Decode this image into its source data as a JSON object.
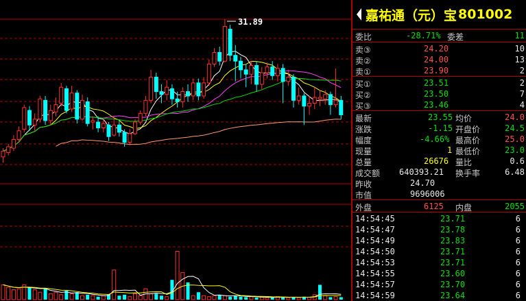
{
  "header": {
    "name": "嘉祐通（元）宝",
    "code": "801002"
  },
  "chart": {
    "peak_label": "31.89",
    "candles": [
      {
        "o": 22.4,
        "c": 22.8,
        "h": 23.0,
        "l": 22.0,
        "dir": "up"
      },
      {
        "o": 22.7,
        "c": 23.1,
        "h": 23.3,
        "l": 22.5,
        "dir": "up"
      },
      {
        "o": 23.0,
        "c": 23.6,
        "h": 23.9,
        "l": 22.8,
        "dir": "up"
      },
      {
        "o": 23.6,
        "c": 24.2,
        "h": 24.5,
        "l": 23.4,
        "dir": "up"
      },
      {
        "o": 24.3,
        "c": 25.8,
        "h": 26.0,
        "l": 24.1,
        "dir": "up"
      },
      {
        "o": 25.6,
        "c": 24.6,
        "h": 25.9,
        "l": 24.2,
        "dir": "down"
      },
      {
        "o": 24.6,
        "c": 25.0,
        "h": 25.4,
        "l": 24.2,
        "dir": "up"
      },
      {
        "o": 25.0,
        "c": 26.4,
        "h": 26.6,
        "l": 24.8,
        "dir": "up"
      },
      {
        "o": 26.3,
        "c": 24.9,
        "h": 26.6,
        "l": 24.6,
        "dir": "down"
      },
      {
        "o": 24.9,
        "c": 25.6,
        "h": 26.0,
        "l": 24.6,
        "dir": "up"
      },
      {
        "o": 25.5,
        "c": 26.0,
        "h": 26.5,
        "l": 25.2,
        "dir": "up"
      },
      {
        "o": 26.1,
        "c": 27.2,
        "h": 27.5,
        "l": 25.9,
        "dir": "up"
      },
      {
        "o": 27.1,
        "c": 25.6,
        "h": 27.3,
        "l": 25.4,
        "dir": "down"
      },
      {
        "o": 25.7,
        "c": 26.8,
        "h": 27.3,
        "l": 25.5,
        "dir": "up"
      },
      {
        "o": 26.8,
        "c": 25.0,
        "h": 27.0,
        "l": 24.7,
        "dir": "down"
      },
      {
        "o": 25.0,
        "c": 26.3,
        "h": 26.7,
        "l": 24.9,
        "dir": "up"
      },
      {
        "o": 26.2,
        "c": 24.7,
        "h": 26.5,
        "l": 24.5,
        "dir": "down"
      },
      {
        "o": 24.8,
        "c": 24.9,
        "h": 25.2,
        "l": 24.3,
        "dir": "up"
      },
      {
        "o": 24.8,
        "c": 24.4,
        "h": 25.2,
        "l": 24.1,
        "dir": "down"
      },
      {
        "o": 24.4,
        "c": 24.7,
        "h": 25.0,
        "l": 24.1,
        "dir": "up"
      },
      {
        "o": 24.6,
        "c": 23.8,
        "h": 24.8,
        "l": 23.5,
        "dir": "down"
      },
      {
        "o": 23.9,
        "c": 24.6,
        "h": 25.2,
        "l": 23.8,
        "dir": "up"
      },
      {
        "o": 24.6,
        "c": 24.1,
        "h": 24.9,
        "l": 23.8,
        "dir": "down"
      },
      {
        "o": 24.1,
        "c": 23.4,
        "h": 24.3,
        "l": 23.1,
        "dir": "down"
      },
      {
        "o": 23.4,
        "c": 24.0,
        "h": 24.3,
        "l": 23.2,
        "dir": "up"
      },
      {
        "o": 24.0,
        "c": 24.8,
        "h": 25.0,
        "l": 23.9,
        "dir": "up"
      },
      {
        "o": 24.8,
        "c": 25.4,
        "h": 25.6,
        "l": 24.6,
        "dir": "up"
      },
      {
        "o": 25.4,
        "c": 26.3,
        "h": 26.6,
        "l": 25.2,
        "dir": "up"
      },
      {
        "o": 26.3,
        "c": 27.9,
        "h": 28.4,
        "l": 26.1,
        "dir": "up"
      },
      {
        "o": 27.9,
        "c": 26.9,
        "h": 28.2,
        "l": 26.4,
        "dir": "down"
      },
      {
        "o": 26.9,
        "c": 26.7,
        "h": 27.4,
        "l": 26.1,
        "dir": "down"
      },
      {
        "o": 26.7,
        "c": 27.2,
        "h": 27.7,
        "l": 26.3,
        "dir": "up"
      },
      {
        "o": 27.1,
        "c": 26.4,
        "h": 27.4,
        "l": 26.0,
        "dir": "down"
      },
      {
        "o": 26.4,
        "c": 26.2,
        "h": 26.9,
        "l": 25.8,
        "dir": "down"
      },
      {
        "o": 26.2,
        "c": 26.9,
        "h": 27.2,
        "l": 25.8,
        "dir": "up"
      },
      {
        "o": 26.9,
        "c": 26.6,
        "h": 27.4,
        "l": 26.2,
        "dir": "down"
      },
      {
        "o": 26.6,
        "c": 27.5,
        "h": 27.8,
        "l": 26.3,
        "dir": "up"
      },
      {
        "o": 27.5,
        "c": 26.6,
        "h": 27.8,
        "l": 26.3,
        "dir": "down"
      },
      {
        "o": 26.6,
        "c": 27.5,
        "h": 27.9,
        "l": 26.4,
        "dir": "up"
      },
      {
        "o": 27.5,
        "c": 28.8,
        "h": 29.1,
        "l": 27.3,
        "dir": "up"
      },
      {
        "o": 28.8,
        "c": 29.6,
        "h": 29.9,
        "l": 28.6,
        "dir": "up"
      },
      {
        "o": 29.6,
        "c": 29.0,
        "h": 30.0,
        "l": 28.7,
        "dir": "down"
      },
      {
        "o": 29.0,
        "c": 31.4,
        "h": 31.89,
        "l": 28.9,
        "dir": "up"
      },
      {
        "o": 31.2,
        "c": 29.4,
        "h": 31.5,
        "l": 29.0,
        "dir": "down"
      },
      {
        "o": 29.4,
        "c": 29.0,
        "h": 30.1,
        "l": 27.6,
        "dir": "down"
      },
      {
        "o": 29.0,
        "c": 28.4,
        "h": 29.3,
        "l": 27.8,
        "dir": "down"
      },
      {
        "o": 28.4,
        "c": 28.1,
        "h": 28.8,
        "l": 27.2,
        "dir": "down"
      },
      {
        "o": 28.1,
        "c": 28.7,
        "h": 29.0,
        "l": 27.4,
        "dir": "up"
      },
      {
        "o": 28.7,
        "c": 27.4,
        "h": 29.0,
        "l": 26.9,
        "dir": "down"
      },
      {
        "o": 27.4,
        "c": 28.2,
        "h": 28.6,
        "l": 27.0,
        "dir": "up"
      },
      {
        "o": 28.2,
        "c": 28.6,
        "h": 28.9,
        "l": 27.8,
        "dir": "up"
      },
      {
        "o": 28.6,
        "c": 28.0,
        "h": 29.0,
        "l": 27.7,
        "dir": "down"
      },
      {
        "o": 28.0,
        "c": 28.5,
        "h": 28.8,
        "l": 27.6,
        "dir": "up"
      },
      {
        "o": 28.5,
        "c": 27.6,
        "h": 28.8,
        "l": 26.1,
        "dir": "down"
      },
      {
        "o": 27.6,
        "c": 27.9,
        "h": 28.4,
        "l": 27.3,
        "dir": "up"
      },
      {
        "o": 27.9,
        "c": 26.3,
        "h": 28.1,
        "l": 25.8,
        "dir": "down"
      },
      {
        "o": 26.3,
        "c": 26.6,
        "h": 27.2,
        "l": 26.0,
        "dir": "up"
      },
      {
        "o": 26.6,
        "c": 25.9,
        "h": 26.8,
        "l": 24.6,
        "dir": "down"
      },
      {
        "o": 25.9,
        "c": 26.1,
        "h": 26.6,
        "l": 25.3,
        "dir": "up"
      },
      {
        "o": 26.1,
        "c": 26.5,
        "h": 27.2,
        "l": 25.7,
        "dir": "up"
      },
      {
        "o": 26.5,
        "c": 26.4,
        "h": 27.0,
        "l": 25.9,
        "dir": "up"
      },
      {
        "o": 26.4,
        "c": 26.7,
        "h": 27.0,
        "l": 26.0,
        "dir": "up"
      },
      {
        "o": 26.7,
        "c": 26.0,
        "h": 26.9,
        "l": 25.3,
        "dir": "down"
      },
      {
        "o": 26.0,
        "c": 26.3,
        "h": 28.5,
        "l": 25.8,
        "dir": "up"
      },
      {
        "o": 26.3,
        "c": 25.3,
        "h": 26.6,
        "l": 25.0,
        "dir": "down"
      }
    ],
    "volumes": [
      {
        "v": 0.3,
        "dir": "up"
      },
      {
        "v": 0.25,
        "dir": "up"
      },
      {
        "v": 0.2,
        "dir": "up"
      },
      {
        "v": 0.22,
        "dir": "up"
      },
      {
        "v": 0.3,
        "dir": "up"
      },
      {
        "v": 0.25,
        "dir": "down"
      },
      {
        "v": 0.2,
        "dir": "up"
      },
      {
        "v": 0.15,
        "dir": "up"
      },
      {
        "v": 0.22,
        "dir": "down"
      },
      {
        "v": 0.12,
        "dir": "up"
      },
      {
        "v": 0.15,
        "dir": "up"
      },
      {
        "v": 0.1,
        "dir": "up"
      },
      {
        "v": 0.18,
        "dir": "down"
      },
      {
        "v": 0.12,
        "dir": "up"
      },
      {
        "v": 0.15,
        "dir": "down"
      },
      {
        "v": 0.08,
        "dir": "up"
      },
      {
        "v": 0.1,
        "dir": "down"
      },
      {
        "v": 0.08,
        "dir": "up"
      },
      {
        "v": 0.06,
        "dir": "down"
      },
      {
        "v": 0.08,
        "dir": "up"
      },
      {
        "v": 0.1,
        "dir": "down"
      },
      {
        "v": 0.6,
        "dir": "up"
      },
      {
        "v": 0.08,
        "dir": "down"
      },
      {
        "v": 0.1,
        "dir": "down"
      },
      {
        "v": 0.06,
        "dir": "up"
      },
      {
        "v": 0.12,
        "dir": "up"
      },
      {
        "v": 0.08,
        "dir": "up"
      },
      {
        "v": 0.22,
        "dir": "up"
      },
      {
        "v": 0.12,
        "dir": "up"
      },
      {
        "v": 0.12,
        "dir": "down"
      },
      {
        "v": 0.08,
        "dir": "down"
      },
      {
        "v": 0.06,
        "dir": "up"
      },
      {
        "v": 0.4,
        "dir": "down"
      },
      {
        "v": 0.98,
        "dir": "up"
      },
      {
        "v": 0.55,
        "dir": "up"
      },
      {
        "v": 0.35,
        "dir": "down"
      },
      {
        "v": 0.08,
        "dir": "up"
      },
      {
        "v": 0.15,
        "dir": "down"
      },
      {
        "v": 0.08,
        "dir": "up"
      },
      {
        "v": 0.06,
        "dir": "up"
      },
      {
        "v": 0.08,
        "dir": "up"
      },
      {
        "v": 0.1,
        "dir": "down"
      },
      {
        "v": 0.08,
        "dir": "up"
      },
      {
        "v": 0.06,
        "dir": "down"
      },
      {
        "v": 0.08,
        "dir": "down"
      },
      {
        "v": 0.06,
        "dir": "down"
      },
      {
        "v": 0.05,
        "dir": "down"
      },
      {
        "v": 0.06,
        "dir": "up"
      },
      {
        "v": 0.04,
        "dir": "down"
      },
      {
        "v": 0.05,
        "dir": "up"
      },
      {
        "v": 0.04,
        "dir": "up"
      },
      {
        "v": 0.05,
        "dir": "down"
      },
      {
        "v": 0.06,
        "dir": "up"
      },
      {
        "v": 0.05,
        "dir": "down"
      },
      {
        "v": 0.04,
        "dir": "up"
      },
      {
        "v": 0.05,
        "dir": "down"
      },
      {
        "v": 0.04,
        "dir": "up"
      },
      {
        "v": 0.06,
        "dir": "down"
      },
      {
        "v": 0.05,
        "dir": "up"
      },
      {
        "v": 0.1,
        "dir": "up"
      },
      {
        "v": 0.3,
        "dir": "down"
      },
      {
        "v": 0.08,
        "dir": "up"
      },
      {
        "v": 0.05,
        "dir": "down"
      },
      {
        "v": 0.06,
        "dir": "up"
      },
      {
        "v": 0.05,
        "dir": "down"
      }
    ],
    "colors": {
      "up": "#ff3030",
      "down": "#00ffff",
      "ma5": "#ffffff",
      "ma10": "#ffff00",
      "ma20": "#ff40ff",
      "ma30": "#00dd00",
      "ma60": "#ff9a70",
      "grid": "#b00000"
    }
  },
  "order_book": {
    "ratio_label": "委比",
    "ratio_value": "-28.71%",
    "diff_label": "委差",
    "diff_value": "11",
    "sells": [
      {
        "label": "卖③",
        "price": "24.20",
        "vol": "10"
      },
      {
        "label": "卖②",
        "price": "24.00",
        "vol": "13"
      },
      {
        "label": "卖①",
        "price": "23.90",
        "vol": "2"
      }
    ],
    "buys": [
      {
        "label": "买①",
        "price": "23.51",
        "vol": "2"
      },
      {
        "label": "买②",
        "price": "23.50",
        "vol": "7"
      },
      {
        "label": "买③",
        "price": "23.46",
        "vol": "4"
      }
    ]
  },
  "stats": {
    "latest_label": "最新",
    "latest": "23.55",
    "avg_label": "均价",
    "avg": "24.0",
    "change_label": "涨跌",
    "change": "-1.15",
    "open_label": "开盘价",
    "open": "24.5",
    "amp_label": "幅度",
    "amp": "-4.66%",
    "high_label": "最高价",
    "high": "25.0",
    "cur_vol_label": "现量",
    "cur_vol": "1",
    "low_label": "最低价",
    "low": "23.0",
    "total_vol_label": "总量",
    "total_vol": "26676",
    "vol_ratio_label": "量比",
    "vol_ratio": "0.6",
    "turnover_label": "成交额",
    "turnover": "640393.21",
    "turn_rate_label": "换手率",
    "turn_rate": "6.48",
    "prev_close_label": "昨收",
    "prev_close": "24.70",
    "mkt_cap_label": "市值",
    "mkt_cap": "9696006",
    "outer_label": "外盘",
    "outer": "6125",
    "inner_label": "内盘",
    "inner": "2055"
  },
  "trades": [
    {
      "time": "14:54:45",
      "price": "23.71",
      "vol": "6"
    },
    {
      "time": "14:54:47",
      "price": "23.78",
      "vol": "6"
    },
    {
      "time": "14:54:49",
      "price": "23.83",
      "vol": "6"
    },
    {
      "time": "14:54:50",
      "price": "23.71",
      "vol": "6"
    },
    {
      "time": "14:54:53",
      "price": "23.71",
      "vol": "6"
    },
    {
      "time": "14:54:55",
      "price": "23.60",
      "vol": "6"
    },
    {
      "time": "14:54:57",
      "price": "23.70",
      "vol": "6"
    },
    {
      "time": "14:54:59",
      "price": "23.64",
      "vol": "6"
    }
  ]
}
